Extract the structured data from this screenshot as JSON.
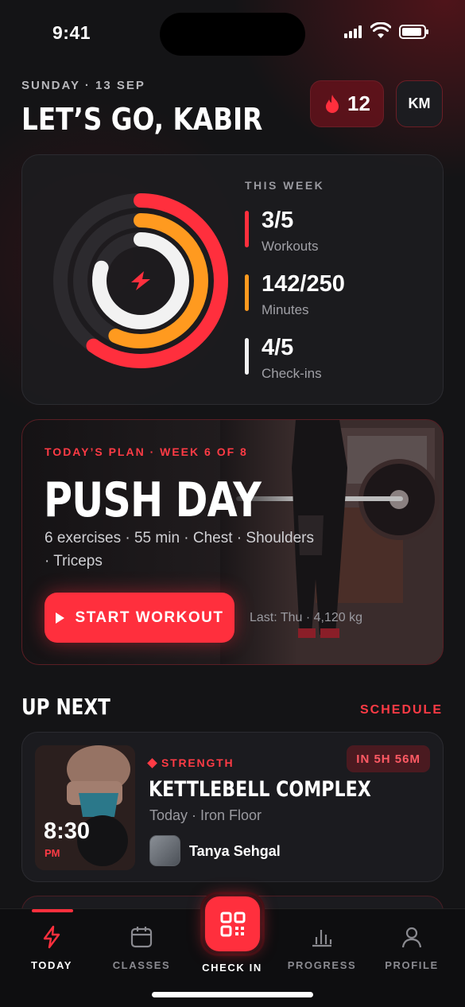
{
  "status_bar": {
    "time": "9:41"
  },
  "header": {
    "date": "SUNDAY · 13 SEP",
    "greeting": "LET’S GO, KABIR",
    "streak_count": "12",
    "avatar_initials": "KM"
  },
  "week": {
    "title": "THIS WEEK",
    "stats": [
      {
        "value": "3/5",
        "label": "Workouts",
        "color": "#ff2f3d",
        "progress": 0.6
      },
      {
        "value": "142/250",
        "label": "Minutes",
        "color": "#ff9a1f",
        "progress": 0.568
      },
      {
        "value": "4/5",
        "label": "Check-ins",
        "color": "#f2f2f2",
        "progress": 0.8
      }
    ]
  },
  "plan": {
    "eyebrow": "TODAY’S PLAN · WEEK 6 OF 8",
    "title": "PUSH DAY",
    "meta": "6 exercises · 55 min · Chest · Shoulders · Triceps",
    "start_label": "START WORKOUT",
    "last": "Last: Thu · 4,120 kg"
  },
  "up_next": {
    "title": "UP NEXT",
    "schedule_label": "SCHEDULE",
    "class": {
      "time": "8:30",
      "ampm": "PM",
      "category": "STRENGTH",
      "countdown": "IN 5H 56M",
      "name": "KETTLEBELL COMPLEX",
      "location": "Today · Iron Floor",
      "trainer": "Tanya Sehgal"
    }
  },
  "tabs": {
    "today": "TODAY",
    "classes": "CLASSES",
    "checkin": "CHECK IN",
    "progress": "PROGRESS",
    "profile": "PROFILE"
  },
  "colors": {
    "accent": "#ff2f3d",
    "orange": "#ff9a1f",
    "background": "#141416"
  },
  "icons": [
    "flame-icon",
    "bolt-icon",
    "play-icon",
    "qr-icon",
    "calendar-icon",
    "chart-icon",
    "person-icon",
    "diamond-icon"
  ]
}
